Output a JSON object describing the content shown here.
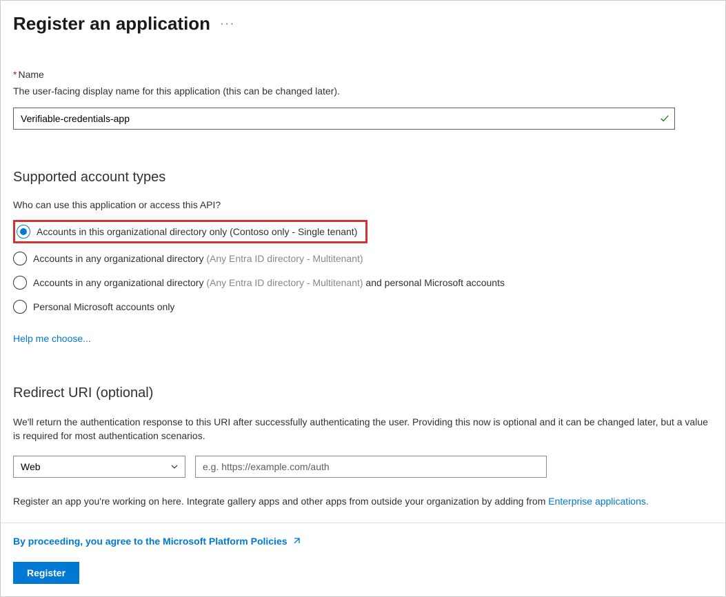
{
  "title": "Register an application",
  "name_field": {
    "label": "Name",
    "description": "The user-facing display name for this application (this can be changed later).",
    "value": "Verifiable-credentials-app"
  },
  "account_types": {
    "heading": "Supported account types",
    "question": "Who can use this application or access this API?",
    "options": [
      {
        "label": "Accounts in this organizational directory only (Contoso only - Single tenant)",
        "selected": true
      },
      {
        "label_prefix": "Accounts in any organizational directory ",
        "label_muted": "(Any Entra ID directory - Multitenant)",
        "label_suffix": "",
        "selected": false
      },
      {
        "label_prefix": "Accounts in any organizational directory ",
        "label_muted": "(Any Entra ID directory - Multitenant)",
        "label_suffix": "  and personal Microsoft accounts",
        "selected": false
      },
      {
        "label_prefix": "Personal Microsoft accounts only",
        "label_muted": "",
        "label_suffix": "",
        "selected": false
      }
    ],
    "help_link": "Help me choose..."
  },
  "redirect": {
    "heading": "Redirect URI (optional)",
    "description": "We'll return the authentication response to this URI after successfully authenticating the user. Providing this now is optional and it can be changed later, but a value is required for most authentication scenarios.",
    "platform_selected": "Web",
    "uri_placeholder": "e.g. https://example.com/auth"
  },
  "integrate_text_prefix": "Register an app you're working on here. Integrate gallery apps and other apps from outside your organization by adding from ",
  "integrate_link": "Enterprise applications.",
  "footer": {
    "policy_text": "By proceeding, you agree to the Microsoft Platform Policies",
    "register_label": "Register"
  }
}
